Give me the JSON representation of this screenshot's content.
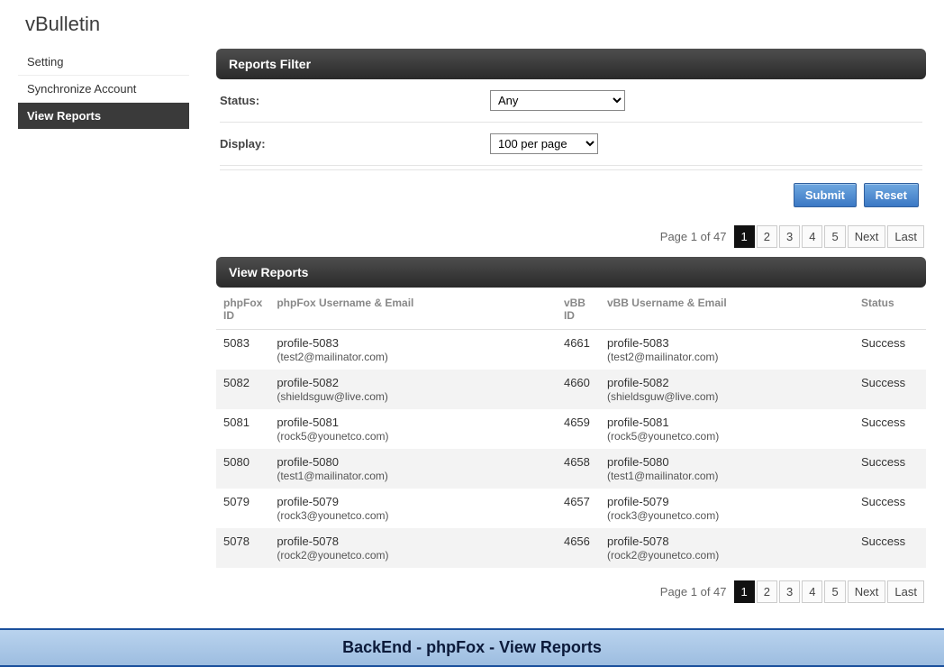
{
  "brand": "vBulletin",
  "sidebar": {
    "items": [
      {
        "label": "Setting",
        "active": false
      },
      {
        "label": "Synchronize Account",
        "active": false
      },
      {
        "label": "View Reports",
        "active": true
      }
    ]
  },
  "filter": {
    "heading": "Reports Filter",
    "status_label": "Status:",
    "status_options": [
      "Any"
    ],
    "status_value": "Any",
    "display_label": "Display:",
    "display_options": [
      "100 per page"
    ],
    "display_value": "100 per page",
    "submit_label": "Submit",
    "reset_label": "Reset"
  },
  "pager": {
    "info": "Page 1 of 47",
    "pages": [
      "1",
      "2",
      "3",
      "4",
      "5"
    ],
    "current": "1",
    "next_label": "Next",
    "last_label": "Last"
  },
  "reports": {
    "heading": "View Reports",
    "columns": {
      "phpfox_id": "phpFox ID",
      "phpfox_user": "phpFox Username & Email",
      "vbb_id": "vBB ID",
      "vbb_user": "vBB Username & Email",
      "status": "Status"
    },
    "rows": [
      {
        "phpfox_id": "5083",
        "phpfox_name": "profile-5083",
        "phpfox_email": "(test2@mailinator.com)",
        "vbb_id": "4661",
        "vbb_name": "profile-5083",
        "vbb_email": "(test2@mailinator.com)",
        "status": "Success"
      },
      {
        "phpfox_id": "5082",
        "phpfox_name": "profile-5082",
        "phpfox_email": "(shieldsguw@live.com)",
        "vbb_id": "4660",
        "vbb_name": "profile-5082",
        "vbb_email": "(shieldsguw@live.com)",
        "status": "Success"
      },
      {
        "phpfox_id": "5081",
        "phpfox_name": "profile-5081",
        "phpfox_email": "(rock5@younetco.com)",
        "vbb_id": "4659",
        "vbb_name": "profile-5081",
        "vbb_email": "(rock5@younetco.com)",
        "status": "Success"
      },
      {
        "phpfox_id": "5080",
        "phpfox_name": "profile-5080",
        "phpfox_email": "(test1@mailinator.com)",
        "vbb_id": "4658",
        "vbb_name": "profile-5080",
        "vbb_email": "(test1@mailinator.com)",
        "status": "Success"
      },
      {
        "phpfox_id": "5079",
        "phpfox_name": "profile-5079",
        "phpfox_email": "(rock3@younetco.com)",
        "vbb_id": "4657",
        "vbb_name": "profile-5079",
        "vbb_email": "(rock3@younetco.com)",
        "status": "Success"
      },
      {
        "phpfox_id": "5078",
        "phpfox_name": "profile-5078",
        "phpfox_email": "(rock2@younetco.com)",
        "vbb_id": "4656",
        "vbb_name": "profile-5078",
        "vbb_email": "(rock2@younetco.com)",
        "status": "Success"
      }
    ]
  },
  "footer": "BackEnd - phpFox - View Reports"
}
